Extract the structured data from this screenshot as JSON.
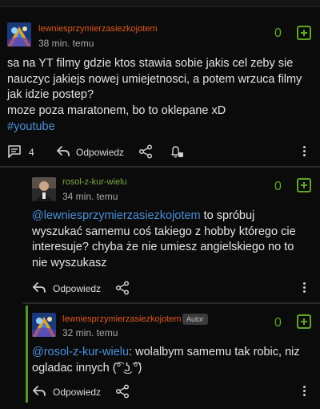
{
  "comment1": {
    "username": "lewniesprzymierzasiezkojotem",
    "time": "38 min. temu",
    "votes": "0",
    "lines": [
      "sa na YT filmy gdzie ktos stawia sobie jakis cel zeby sie",
      "nauczyc jakiejs nowej umiejetnosci, a potem wrzuca filmy",
      "jak idzie postep?",
      "moze poza maratonem, bo to oklepane xD"
    ],
    "tag": "#youtube",
    "comments_count": "4",
    "reply_label": "Odpowiedz"
  },
  "comment2": {
    "username": "rosol-z-kur-wielu",
    "time": "34 min. temu",
    "votes": "0",
    "mention": "@lewniesprzymierzasiezkojotem",
    "line1_rest": " to spróbuj",
    "lines": [
      "wyszukać samemu coś takiego z hobby którego cie",
      "interesuje? chyba że nie umiesz angielskiego no to",
      "nie wyszukasz"
    ],
    "reply_label": "Odpowiedz"
  },
  "comment3": {
    "username": "lewniesprzymierzasiezkojotem",
    "badge": "Autor",
    "time": "32 min. temu",
    "votes": "0",
    "mention": "@rosol-z-kur-wielu",
    "line1_rest": ": wolalbym samemu tak robic, niz",
    "line2": "ogladac innych (͡° ͜ʖ ͡°)",
    "reply_label": "Odpowiedz"
  }
}
